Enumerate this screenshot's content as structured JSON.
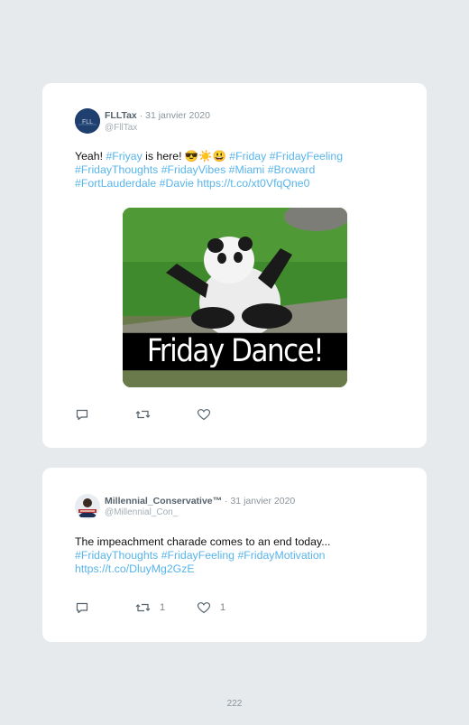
{
  "tweets": [
    {
      "display_name": "FLLTax",
      "date": " · 31 janvier 2020",
      "handle": "@FllTax",
      "text_plain_1": "Yeah! ",
      "link_1": "#Friyay",
      "text_plain_2": " is here! 😎☀️😃 ",
      "link_2": "#Friday #FridayFeeling #FridayThoughts #FridayVibes #Miami #Broward #FortLauderdale #Davie https://t.co/xt0VfqQne0",
      "avatar_text": "FLL",
      "media_caption": "Friday Dance!",
      "reply_count": "",
      "retweet_count": "",
      "like_count": ""
    },
    {
      "display_name": "Millennial_Conservative™",
      "date": " · 31 janvier 2020",
      "handle": "@Millennial_Con_",
      "text_plain_1": "The impeachment charade comes to an end today... ",
      "link_1": "#FridayThoughts #FridayFeeling #FridayMotivation https://t.co/DluyMg2GzE",
      "reply_count": "",
      "retweet_count": "1",
      "like_count": "1"
    }
  ],
  "icons": {
    "reply": "reply-icon",
    "retweet": "retweet-icon",
    "like": "heart-icon"
  },
  "colors": {
    "link": "#58b4ea",
    "background": "#e6eaed",
    "card": "#ffffff",
    "avatar_blue": "#1f3f6e"
  },
  "page_number": "222"
}
